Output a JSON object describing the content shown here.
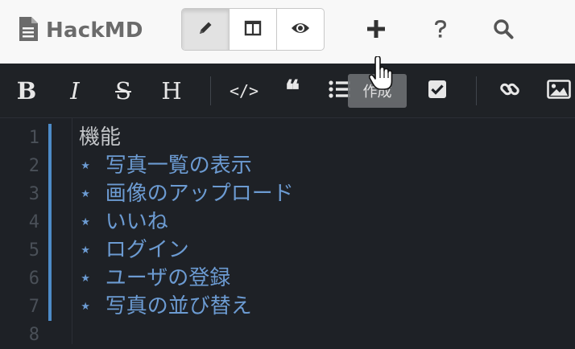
{
  "header": {
    "brand": "HackMD",
    "view_modes": [
      {
        "name": "edit",
        "icon": "pencil-icon",
        "active": true
      },
      {
        "name": "both",
        "icon": "split-columns-icon",
        "active": false
      },
      {
        "name": "view",
        "icon": "eye-icon",
        "active": false
      }
    ],
    "actions": [
      {
        "name": "new-note",
        "icon": "plus-icon"
      },
      {
        "name": "help",
        "icon": "question-icon"
      },
      {
        "name": "search",
        "icon": "search-icon"
      }
    ]
  },
  "toolbar": {
    "bold": "B",
    "italic": "I",
    "strikethrough": "S",
    "heading": "H",
    "code": "</>",
    "quote": "❝",
    "tooltip": "作成"
  },
  "editor": {
    "lines": [
      {
        "n": "1",
        "text": "機能"
      },
      {
        "n": "2",
        "text": "⋆  写真一覧の表示"
      },
      {
        "n": "3",
        "text": "⋆  画像のアップロード"
      },
      {
        "n": "4",
        "text": "⋆  いいね"
      },
      {
        "n": "5",
        "text": "⋆  ログイン"
      },
      {
        "n": "6",
        "text": "⋆  ユーザの登録"
      },
      {
        "n": "7",
        "text": "⋆  写真の並び替え"
      },
      {
        "n": "8",
        "text": ""
      }
    ]
  },
  "colors": {
    "editor_bg": "#1e2126",
    "list_text": "#6c9bd2",
    "heading_text": "#c2c4c7",
    "change_bar": "#4d8bc7"
  }
}
